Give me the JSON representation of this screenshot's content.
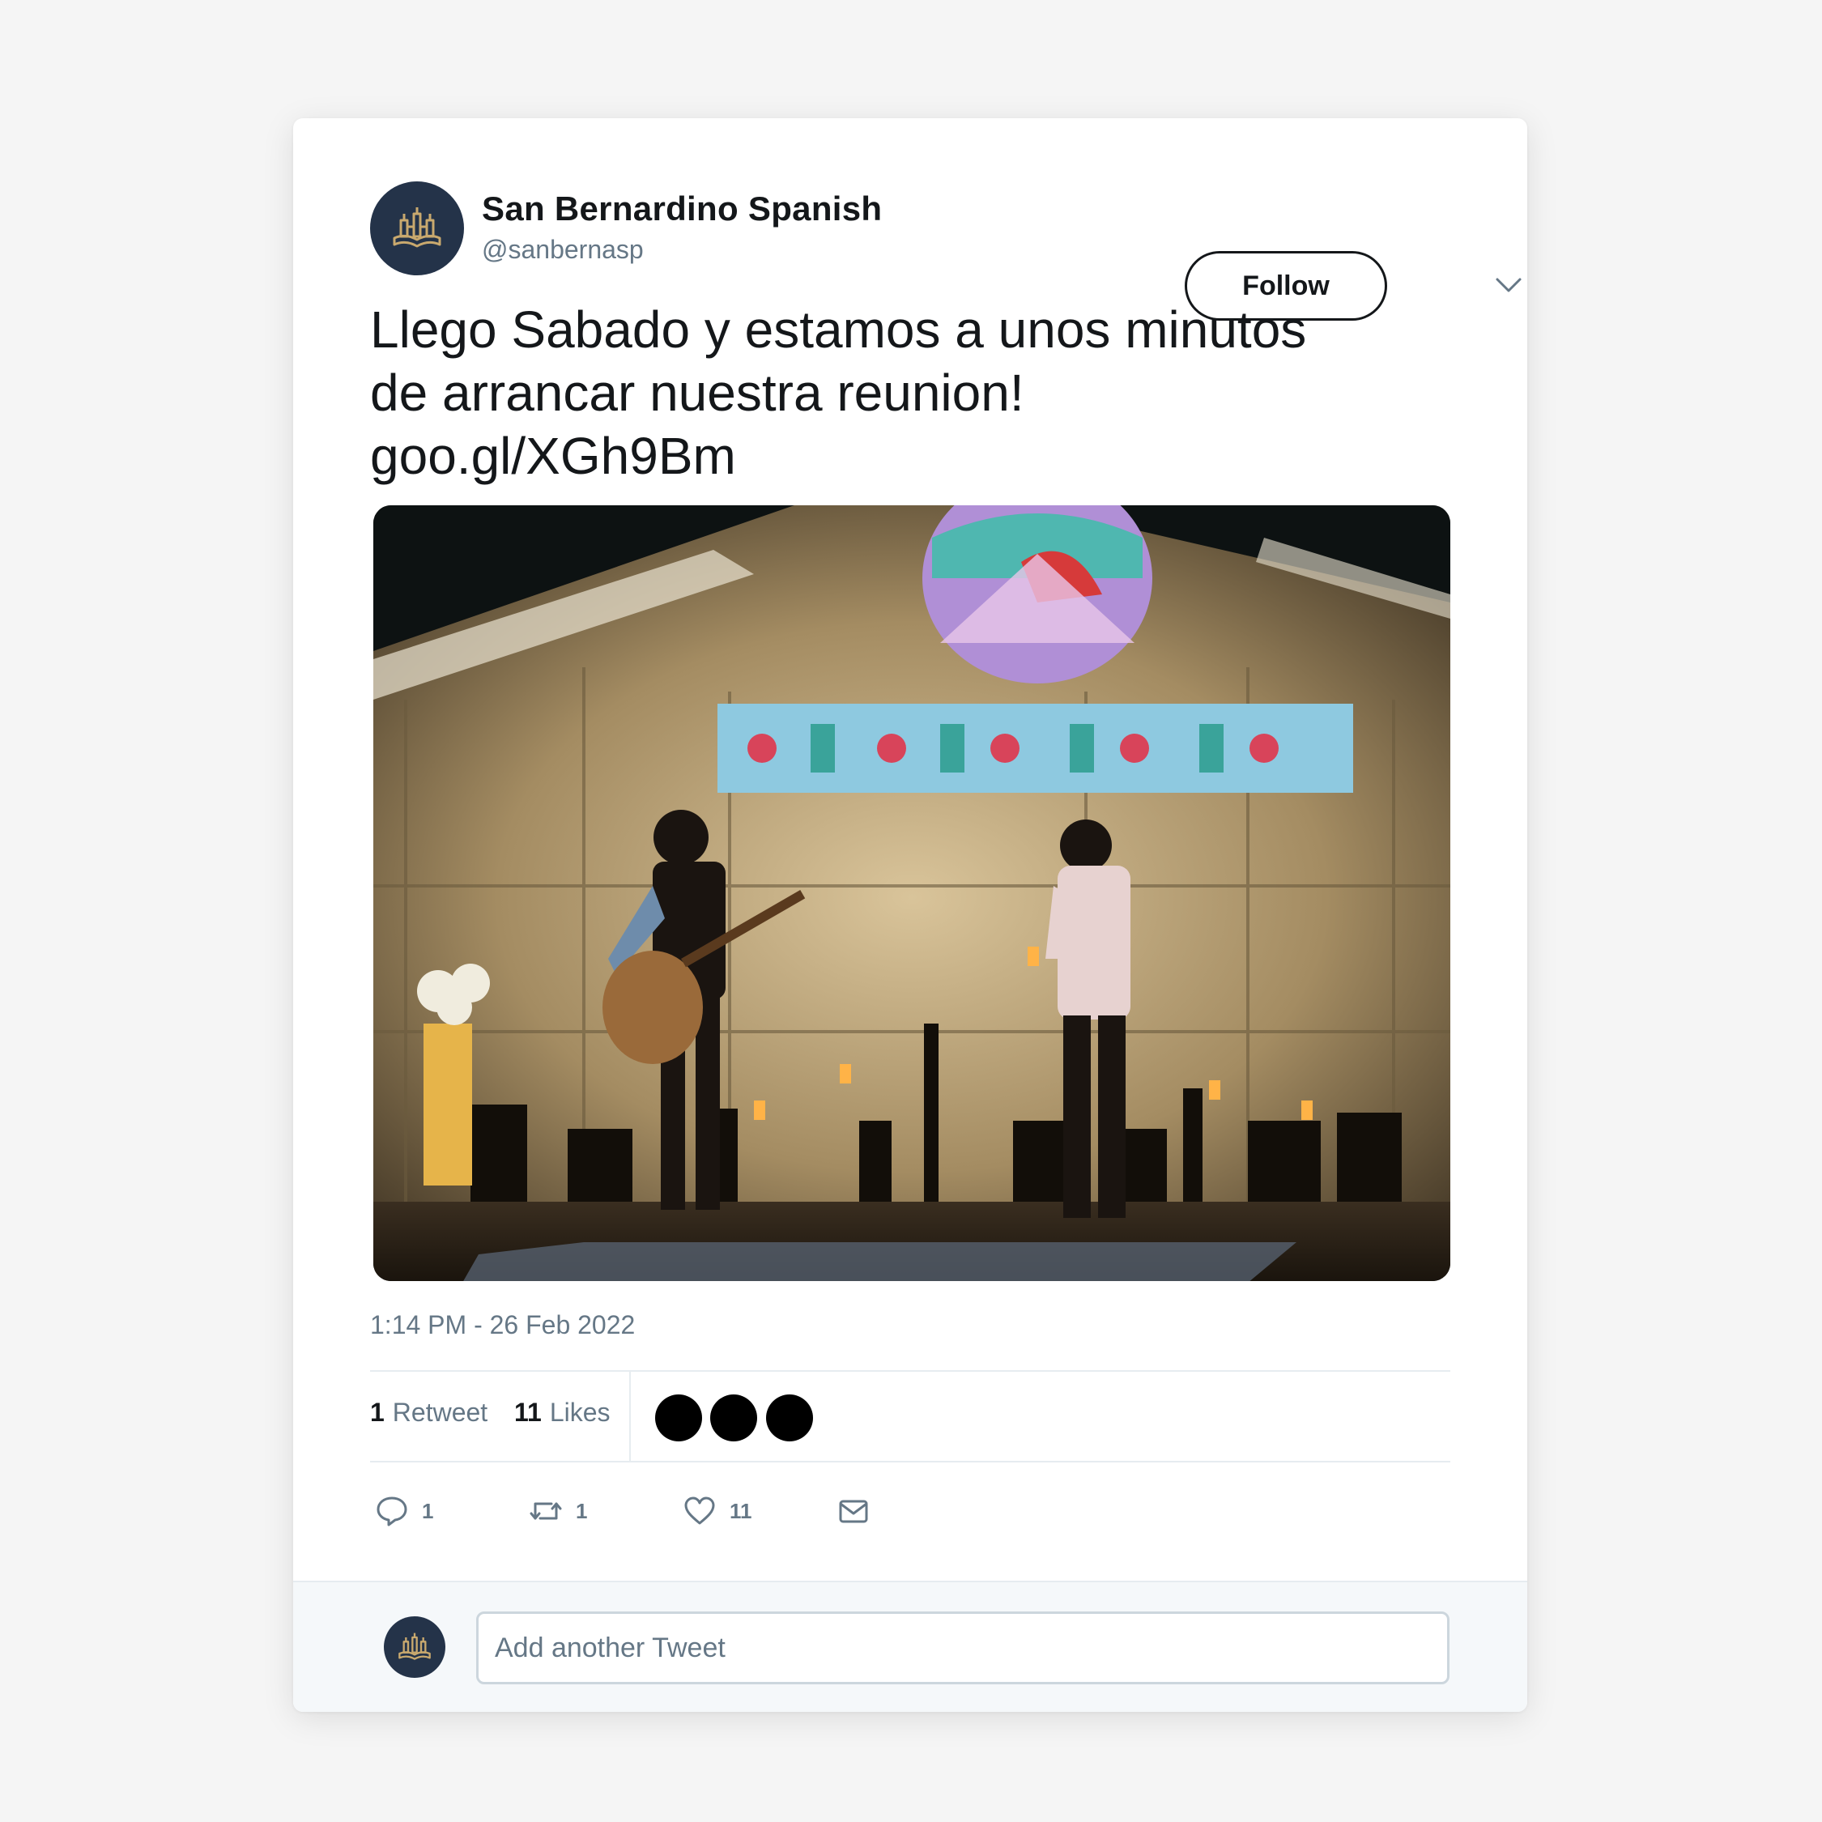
{
  "author": {
    "display_name": "San Bernardino Spanish",
    "handle": "@sanbernasp",
    "avatar_icon": "church-book-logo-icon",
    "avatar_bg": "#243349",
    "avatar_fg": "#c9a96e"
  },
  "header": {
    "follow_label": "Follow",
    "more_icon": "chevron-down-icon"
  },
  "tweet": {
    "lines": [
      "Llego Sabado y estamos a unos minutos",
      "de arrancar nuestra reunion!",
      "goo.gl/XGh9Bm"
    ],
    "media_description_icon": "photo-worship-band-stage",
    "timestamp": "1:14 PM - 26 Feb 2022"
  },
  "stats": {
    "retweets_count": "1",
    "retweets_label": "Retweet",
    "likes_count": "11",
    "likes_label": "Likes"
  },
  "actions": {
    "reply_count": "1",
    "retweet_count": "1",
    "like_count": "11"
  },
  "reply_bar": {
    "placeholder": "Add another Tweet"
  },
  "colors": {
    "text_primary": "#14171a",
    "text_secondary": "#657786",
    "divider": "#e6ecf0",
    "reply_bg": "#f5f8fa"
  }
}
